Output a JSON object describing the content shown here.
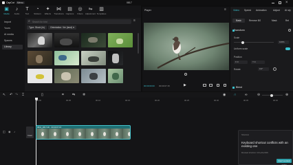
{
  "app": {
    "name": "CapCut",
    "menu_label": "Menu",
    "project_title": "0817"
  },
  "colors": {
    "accent": "#3ac2cf",
    "clip_fill": "#1f6f73",
    "clip_border": "#44c3cc",
    "panel": "#1a1a1c",
    "background": "#0e0e0f"
  },
  "media_tools": [
    {
      "label": "Media",
      "icon": "media-icon",
      "active": true
    },
    {
      "label": "Audio",
      "icon": "audio-icon"
    },
    {
      "label": "Text",
      "icon": "text-icon"
    },
    {
      "label": "Stickers",
      "icon": "stickers-icon"
    },
    {
      "label": "Effects",
      "icon": "effects-icon"
    },
    {
      "label": "Transitions",
      "icon": "transitions-icon"
    },
    {
      "label": "Captions",
      "icon": "captions-icon"
    },
    {
      "label": "Filters",
      "icon": "filters-icon"
    },
    {
      "label": "Adjustment",
      "icon": "adjustment-icon"
    },
    {
      "label": "Templates",
      "icon": "templates-icon"
    }
  ],
  "sidebar": {
    "items": [
      "Import",
      "Yours",
      "AI media",
      "Spaces",
      "Library"
    ]
  },
  "media": {
    "search_placeholder": "Search for bird",
    "chips": [
      "Type: Stock (in)",
      "Orientation: Ver (land) ▾"
    ]
  },
  "player": {
    "title": "Player",
    "timecode_current": "00:00:00:00",
    "timecode_total": "00:00:07:15"
  },
  "inspector": {
    "tabs": [
      "Video",
      "Speed",
      "Animation",
      "Adjust",
      "AI sty"
    ],
    "subtabs": [
      "Basic",
      "Remove BG",
      "Mask",
      "Ret"
    ],
    "section_transform": "Transform",
    "label_scale": "Scale",
    "scale_value": "100%",
    "label_uniform": "Uniform scale",
    "label_position": "Position",
    "pos_x": "X  0",
    "pos_y": "Y  0",
    "label_rotate": "Rotate",
    "rotate_value": "0.0°",
    "section_blend": "Blend"
  },
  "timeline": {
    "ticks": [
      "00:00",
      "00:05",
      "00:10",
      "00:15",
      "00:20",
      "00:25",
      "00:30",
      "00:35",
      "00:40"
    ],
    "cover_label": "Cover",
    "clip_label": "0816_0817.00 · 00:00:07:15"
  },
  "toast": {
    "header": "Shortcut",
    "message": "Keyboard shortcut conflicts with an existing one",
    "detail": "Revised shortcut: Ctrl+Alt+Shift",
    "button": "Don't remind again"
  }
}
